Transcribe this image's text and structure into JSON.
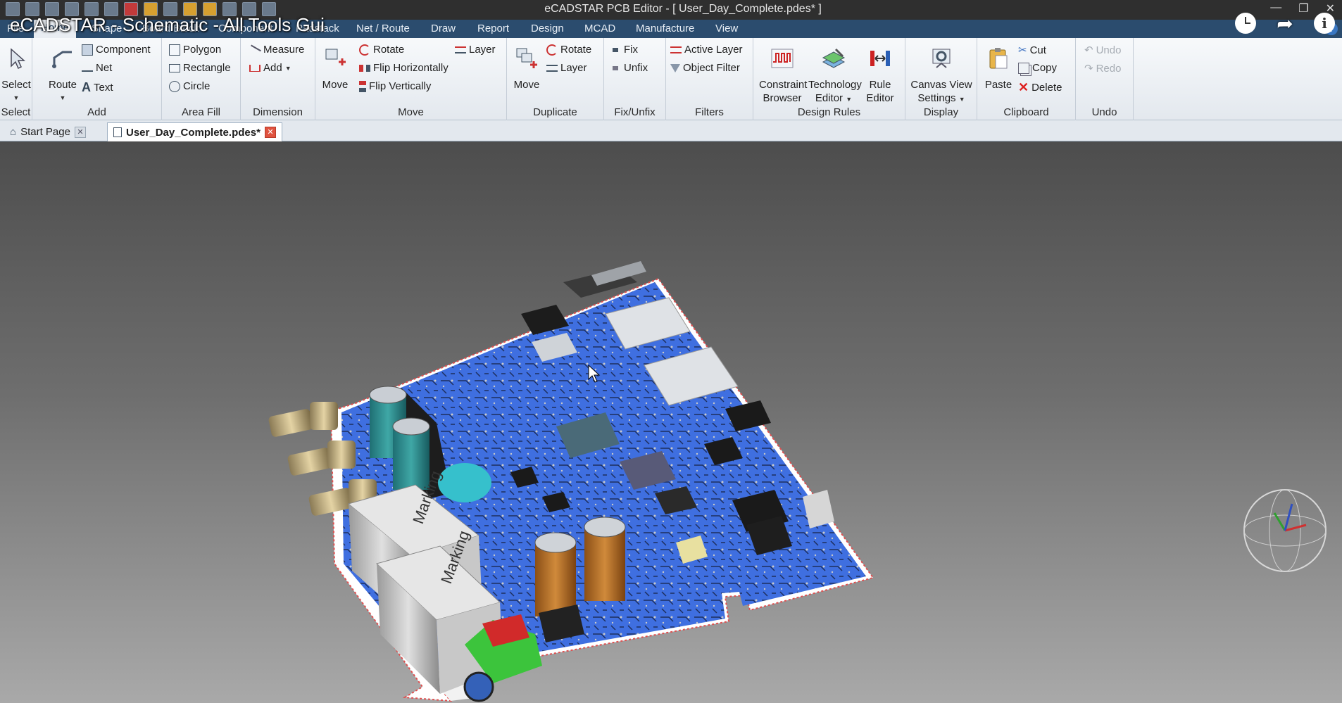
{
  "video_title": "eCADSTAR - Schematic - All Tools Gui",
  "app_title": "eCADSTAR PCB Editor - [ User_Day_Complete.pdes* ]",
  "menu_tabs": [
    "File",
    "Home",
    "Shape",
    "Board Block",
    "Component",
    "Padstack",
    "Net / Route",
    "Draw",
    "Report",
    "Design",
    "MCAD",
    "Manufacture",
    "View"
  ],
  "ribbon": {
    "select": {
      "button": "Select",
      "label": "Select"
    },
    "add": {
      "route": "Route",
      "component": "Component",
      "net": "Net",
      "text": "Text",
      "label": "Add"
    },
    "area_fill": {
      "polygon": "Polygon",
      "rectangle": "Rectangle",
      "circle": "Circle",
      "label": "Area Fill"
    },
    "dimension": {
      "measure": "Measure",
      "add": "Add",
      "label": "Dimension"
    },
    "move": {
      "move": "Move",
      "rotate": "Rotate",
      "flip_h": "Flip Horizontally",
      "flip_v": "Flip Vertically",
      "layer": "Layer",
      "label": "Move"
    },
    "duplicate": {
      "move": "Move",
      "rotate": "Rotate",
      "layer": "Layer",
      "label": "Duplicate"
    },
    "fix": {
      "fix": "Fix",
      "unfix": "Unfix",
      "label": "Fix/Unfix"
    },
    "filters": {
      "active_layer": "Active Layer",
      "object_filter": "Object Filter",
      "label": "Filters"
    },
    "design_rules": {
      "constraint_1": "Constraint",
      "constraint_2": "Browser",
      "technology_1": "Technology",
      "technology_2": "Editor",
      "rule_1": "Rule",
      "rule_2": "Editor",
      "label": "Design Rules"
    },
    "display": {
      "canvas_1": "Canvas View",
      "canvas_2": "Settings",
      "label": "Display"
    },
    "clipboard": {
      "paste": "Paste",
      "cut": "Cut",
      "copy": "Copy",
      "delete": "Delete",
      "label": "Clipboard"
    },
    "undo": {
      "undo": "Undo",
      "redo": "Redo",
      "label": "Undo"
    }
  },
  "doc_tabs": {
    "start": "Start Page",
    "active": "User_Day_Complete.pdes*"
  },
  "board_text": {
    "label_1": "Marking",
    "label_2": "Marking"
  },
  "colors": {
    "board": "#3f6fe0",
    "menubar": "#2b4c6e",
    "ribbon": "#eef2f6"
  }
}
